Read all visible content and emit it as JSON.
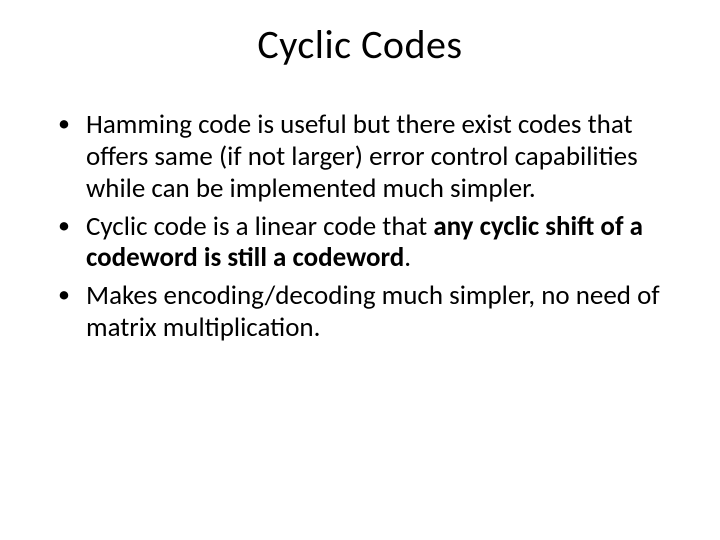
{
  "title": "Cyclic Codes",
  "bullets": {
    "b1": "Hamming code is useful but there exist codes that offers same (if not larger) error control capabilities while can be implemented much simpler.",
    "b2a": "Cyclic code is a linear code that ",
    "b2b": "any cyclic shift of a codeword is still a codeword",
    "b2c": ".",
    "b3": "Makes encoding/decoding much simpler, no need of matrix multiplication."
  }
}
